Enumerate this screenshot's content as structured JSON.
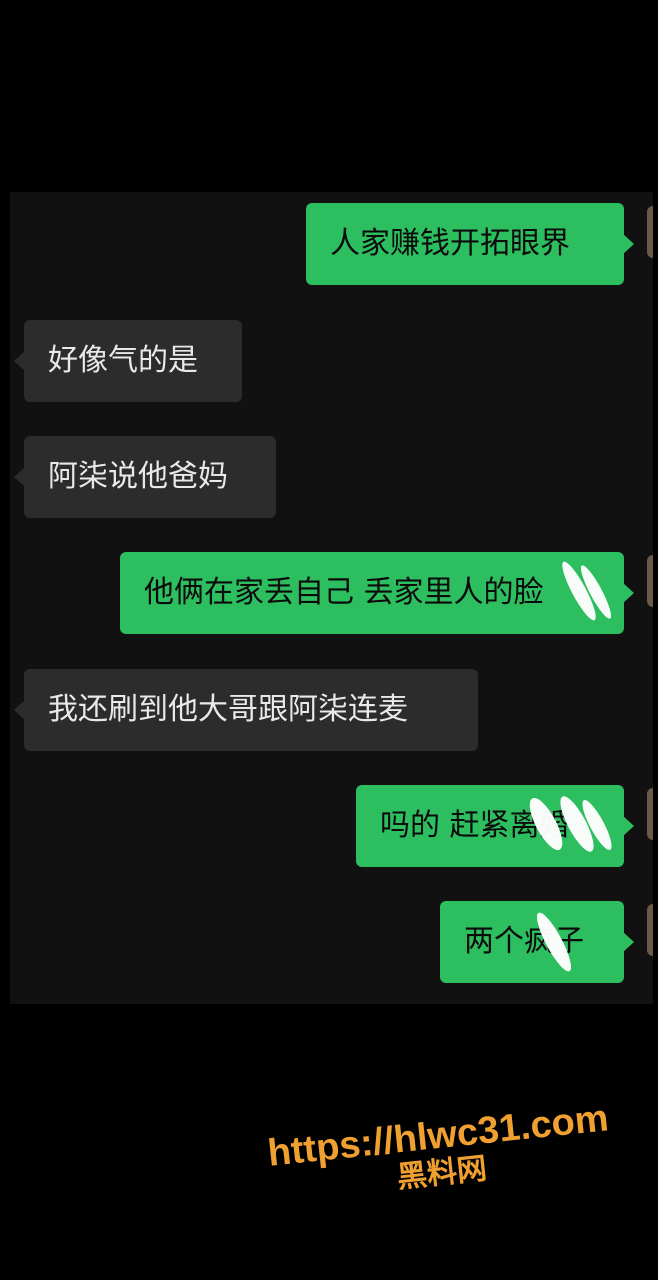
{
  "messages": [
    {
      "side": "out",
      "text": "人家赚钱开拓眼界"
    },
    {
      "side": "in",
      "text": "好像气的是"
    },
    {
      "side": "in",
      "text": "阿柒说他爸妈"
    },
    {
      "side": "out",
      "text": "他俩在家丢自己  丢家里人的脸"
    },
    {
      "side": "in",
      "text": "我还刷到他大哥跟阿柒连麦"
    },
    {
      "side": "out",
      "text": "吗的  赶紧离婚"
    },
    {
      "side": "out",
      "text": "两个疯子"
    }
  ],
  "watermark": {
    "url": "https://hlwc31.com",
    "name": "黑料网",
    "color": "#f0a030"
  },
  "colors": {
    "outgoing_bubble": "#2dbe60",
    "incoming_bubble": "#2c2c2c",
    "chat_background": "#111111"
  }
}
